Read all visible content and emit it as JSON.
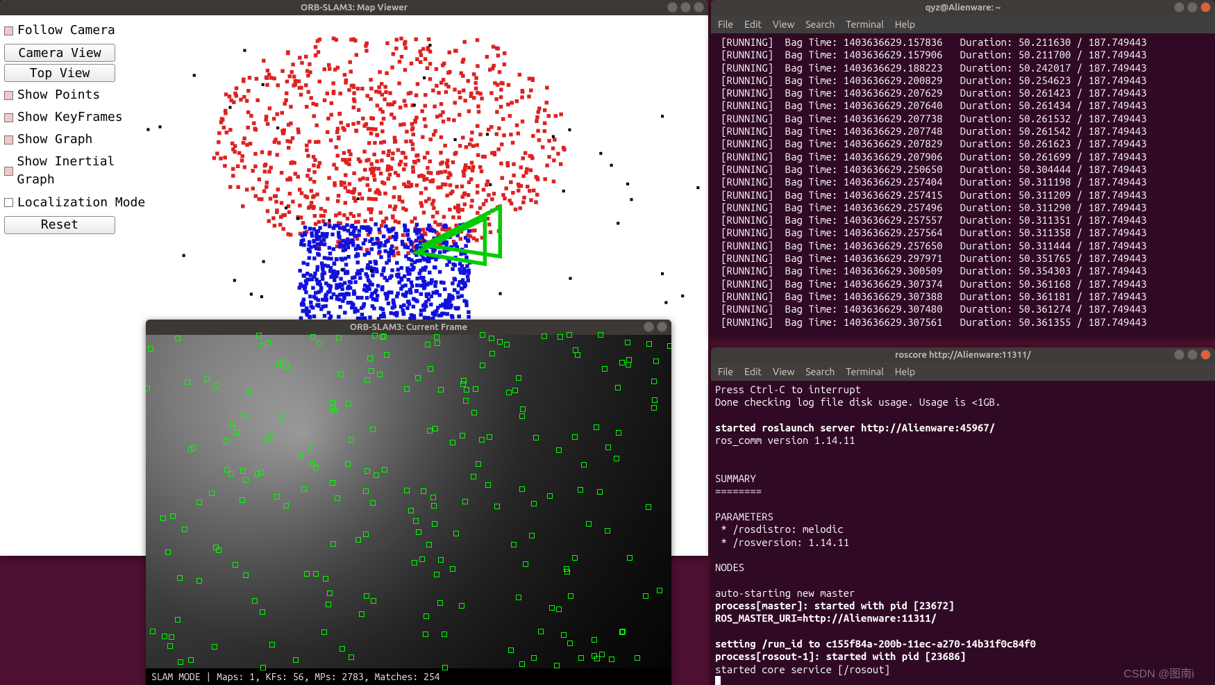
{
  "mapviewer": {
    "title": "ORB-SLAM3: Map Viewer",
    "controls": {
      "follow_camera": "Follow Camera",
      "camera_view": "Camera View",
      "top_view": "Top View",
      "show_points": "Show Points",
      "show_keyframes": "Show KeyFrames",
      "show_graph": "Show Graph",
      "show_inertial_graph": "Show Inertial Graph",
      "localization_mode": "Localization Mode",
      "reset": "Reset"
    }
  },
  "currentframe": {
    "title": "ORB-SLAM3: Current Frame",
    "status": "SLAM MODE |  Maps: 1, KFs: 56, MPs: 2783, Matches: 254"
  },
  "terminal1": {
    "title": "qyz@Alienware: ~",
    "menu": [
      "File",
      "Edit",
      "View",
      "Search",
      "Terminal",
      "Help"
    ],
    "log": [
      [
        "[RUNNING]",
        "Bag Time: 1403636629.157836",
        "Duration: 50.211630 / 187.749443"
      ],
      [
        "[RUNNING]",
        "Bag Time: 1403636629.157906",
        "Duration: 50.211700 / 187.749443"
      ],
      [
        "[RUNNING]",
        "Bag Time: 1403636629.188223",
        "Duration: 50.242017 / 187.749443"
      ],
      [
        "[RUNNING]",
        "Bag Time: 1403636629.200829",
        "Duration: 50.254623 / 187.749443"
      ],
      [
        "[RUNNING]",
        "Bag Time: 1403636629.207629",
        "Duration: 50.261423 / 187.749443"
      ],
      [
        "[RUNNING]",
        "Bag Time: 1403636629.207640",
        "Duration: 50.261434 / 187.749443"
      ],
      [
        "[RUNNING]",
        "Bag Time: 1403636629.207738",
        "Duration: 50.261532 / 187.749443"
      ],
      [
        "[RUNNING]",
        "Bag Time: 1403636629.207748",
        "Duration: 50.261542 / 187.749443"
      ],
      [
        "[RUNNING]",
        "Bag Time: 1403636629.207829",
        "Duration: 50.261623 / 187.749443"
      ],
      [
        "[RUNNING]",
        "Bag Time: 1403636629.207906",
        "Duration: 50.261699 / 187.749443"
      ],
      [
        "[RUNNING]",
        "Bag Time: 1403636629.250650",
        "Duration: 50.304444 / 187.749443"
      ],
      [
        "[RUNNING]",
        "Bag Time: 1403636629.257404",
        "Duration: 50.311198 / 187.749443"
      ],
      [
        "[RUNNING]",
        "Bag Time: 1403636629.257415",
        "Duration: 50.311209 / 187.749443"
      ],
      [
        "[RUNNING]",
        "Bag Time: 1403636629.257496",
        "Duration: 50.311290 / 187.749443"
      ],
      [
        "[RUNNING]",
        "Bag Time: 1403636629.257557",
        "Duration: 50.311351 / 187.749443"
      ],
      [
        "[RUNNING]",
        "Bag Time: 1403636629.257564",
        "Duration: 50.311358 / 187.749443"
      ],
      [
        "[RUNNING]",
        "Bag Time: 1403636629.257650",
        "Duration: 50.311444 / 187.749443"
      ],
      [
        "[RUNNING]",
        "Bag Time: 1403636629.297971",
        "Duration: 50.351765 / 187.749443"
      ],
      [
        "[RUNNING]",
        "Bag Time: 1403636629.300509",
        "Duration: 50.354303 / 187.749443"
      ],
      [
        "[RUNNING]",
        "Bag Time: 1403636629.307374",
        "Duration: 50.361168 / 187.749443"
      ],
      [
        "[RUNNING]",
        "Bag Time: 1403636629.307388",
        "Duration: 50.361181 / 187.749443"
      ],
      [
        "[RUNNING]",
        "Bag Time: 1403636629.307480",
        "Duration: 50.361274 / 187.749443"
      ],
      [
        "[RUNNING]",
        "Bag Time: 1403636629.307561",
        "Duration: 50.361355 / 187.749443"
      ]
    ]
  },
  "terminal2": {
    "title": "roscore http://Alienware:11311/",
    "menu": [
      "File",
      "Edit",
      "View",
      "Search",
      "Terminal",
      "Help"
    ],
    "lines": [
      "Press Ctrl-C to interrupt",
      "Done checking log file disk usage. Usage is <1GB.",
      "",
      "started roslaunch server http://Alienware:45967/",
      "ros_comm version 1.14.11",
      "",
      "",
      "SUMMARY",
      "========",
      "",
      "PARAMETERS",
      " * /rosdistro: melodic",
      " * /rosversion: 1.14.11",
      "",
      "NODES",
      "",
      "auto-starting new master",
      "process[master]: started with pid [23672]",
      "ROS_MASTER_URI=http://Alienware:11311/",
      "",
      "setting /run_id to c155f84a-200b-11ec-a270-14b31f0c84f0",
      "process[rosout-1]: started with pid [23686]",
      "started core service [/rosout]"
    ],
    "bold_lines": [
      3,
      17,
      18,
      20,
      21
    ]
  },
  "watermark": "CSDN @图南i"
}
